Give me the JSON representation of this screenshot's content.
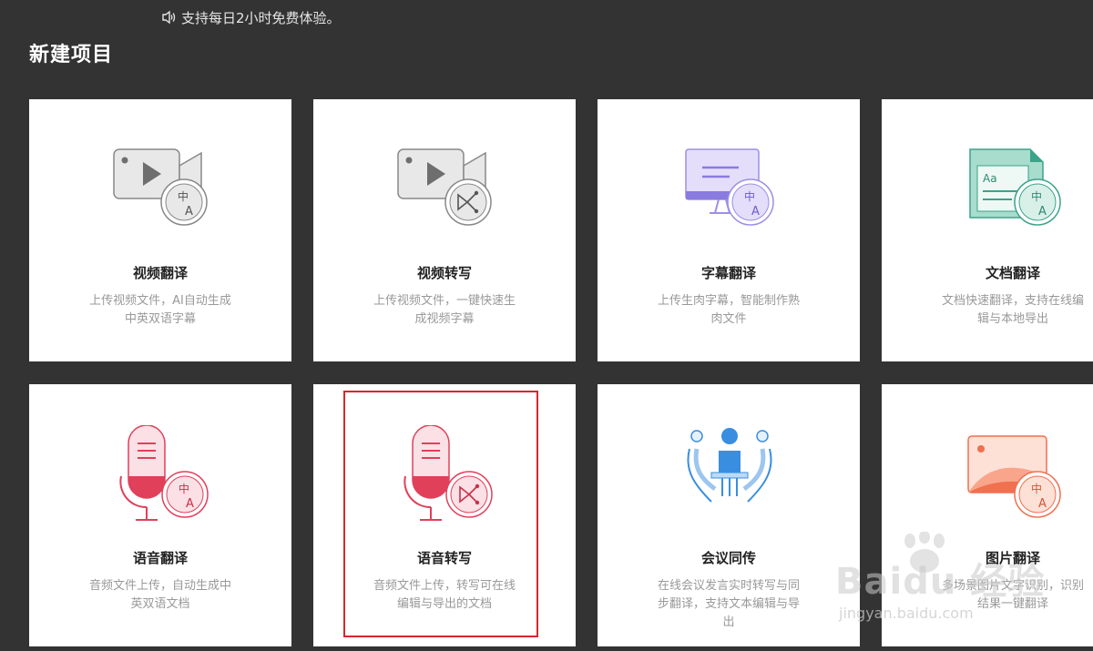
{
  "notice": {
    "icon": "speaker-icon",
    "text": "支持每日2小时免费体验。"
  },
  "section": {
    "title": "新建项目"
  },
  "cards": [
    {
      "title": "视频翻译",
      "desc": "上传视频文件，AI自动生成中英双语字幕",
      "icon": "video-translate-icon"
    },
    {
      "title": "视频转写",
      "desc": "上传视频文件，一键快速生成视频字幕",
      "icon": "video-transcribe-icon"
    },
    {
      "title": "字幕翻译",
      "desc": "上传生肉字幕，智能制作熟肉文件",
      "icon": "subtitle-translate-icon"
    },
    {
      "title": "文档翻译",
      "desc": "文档快速翻译，支持在线编辑与本地导出",
      "icon": "document-translate-icon"
    },
    {
      "title": "语音翻译",
      "desc": "音频文件上传，自动生成中英双语文档",
      "icon": "audio-translate-icon"
    },
    {
      "title": "语音转写",
      "desc": "音频文件上传，转写可在线编辑与导出的文档",
      "icon": "audio-transcribe-icon"
    },
    {
      "title": "会议同传",
      "desc": "在线会议发言实时转写与同步翻译，支持文本编辑与导出",
      "icon": "meeting-interpret-icon"
    },
    {
      "title": "图片翻译",
      "desc": "多场景图片文字识别，识别结果一键翻译",
      "icon": "image-translate-icon"
    }
  ],
  "watermark": {
    "brand": "Baidu 经验",
    "site": "jingyan.baidu.com"
  },
  "colors": {
    "background": "#333333",
    "card": "#ffffff",
    "highlight": "#d6272c",
    "gray_icon": "#6e6e6e",
    "purple_icon": "#8a7be0",
    "teal_icon": "#3aa388",
    "red_icon": "#e0405a",
    "blue_icon": "#3a8ee0",
    "orange_icon": "#f07050"
  }
}
